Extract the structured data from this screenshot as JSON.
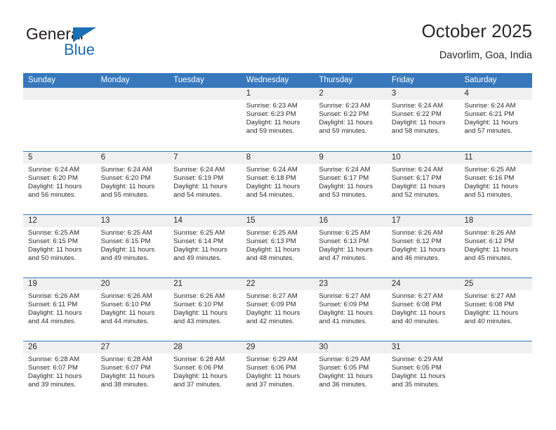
{
  "brand": {
    "name_part1": "General",
    "name_part2": "Blue",
    "triangle_color": "#1a6fb4"
  },
  "header": {
    "title": "October 2025",
    "subtitle": "Davorlim, Goa, India"
  },
  "theme": {
    "header_blue": "#3778bd",
    "day_band_gray": "#f0f0f0",
    "text_color": "#2b2b2b"
  },
  "weekdays": [
    "Sunday",
    "Monday",
    "Tuesday",
    "Wednesday",
    "Thursday",
    "Friday",
    "Saturday"
  ],
  "weeks": [
    [
      {
        "day": "",
        "sunrise": "",
        "sunset": "",
        "daylight_line1": "",
        "daylight_line2": "",
        "empty": true
      },
      {
        "day": "",
        "sunrise": "",
        "sunset": "",
        "daylight_line1": "",
        "daylight_line2": "",
        "empty": true
      },
      {
        "day": "",
        "sunrise": "",
        "sunset": "",
        "daylight_line1": "",
        "daylight_line2": "",
        "empty": true
      },
      {
        "day": "1",
        "sunrise": "Sunrise: 6:23 AM",
        "sunset": "Sunset: 6:23 PM",
        "daylight_line1": "Daylight: 11 hours",
        "daylight_line2": "and 59 minutes.",
        "empty": false
      },
      {
        "day": "2",
        "sunrise": "Sunrise: 6:23 AM",
        "sunset": "Sunset: 6:22 PM",
        "daylight_line1": "Daylight: 11 hours",
        "daylight_line2": "and 59 minutes.",
        "empty": false
      },
      {
        "day": "3",
        "sunrise": "Sunrise: 6:24 AM",
        "sunset": "Sunset: 6:22 PM",
        "daylight_line1": "Daylight: 11 hours",
        "daylight_line2": "and 58 minutes.",
        "empty": false
      },
      {
        "day": "4",
        "sunrise": "Sunrise: 6:24 AM",
        "sunset": "Sunset: 6:21 PM",
        "daylight_line1": "Daylight: 11 hours",
        "daylight_line2": "and 57 minutes.",
        "empty": false
      }
    ],
    [
      {
        "day": "5",
        "sunrise": "Sunrise: 6:24 AM",
        "sunset": "Sunset: 6:20 PM",
        "daylight_line1": "Daylight: 11 hours",
        "daylight_line2": "and 56 minutes.",
        "empty": false
      },
      {
        "day": "6",
        "sunrise": "Sunrise: 6:24 AM",
        "sunset": "Sunset: 6:20 PM",
        "daylight_line1": "Daylight: 11 hours",
        "daylight_line2": "and 55 minutes.",
        "empty": false
      },
      {
        "day": "7",
        "sunrise": "Sunrise: 6:24 AM",
        "sunset": "Sunset: 6:19 PM",
        "daylight_line1": "Daylight: 11 hours",
        "daylight_line2": "and 54 minutes.",
        "empty": false
      },
      {
        "day": "8",
        "sunrise": "Sunrise: 6:24 AM",
        "sunset": "Sunset: 6:18 PM",
        "daylight_line1": "Daylight: 11 hours",
        "daylight_line2": "and 54 minutes.",
        "empty": false
      },
      {
        "day": "9",
        "sunrise": "Sunrise: 6:24 AM",
        "sunset": "Sunset: 6:17 PM",
        "daylight_line1": "Daylight: 11 hours",
        "daylight_line2": "and 53 minutes.",
        "empty": false
      },
      {
        "day": "10",
        "sunrise": "Sunrise: 6:24 AM",
        "sunset": "Sunset: 6:17 PM",
        "daylight_line1": "Daylight: 11 hours",
        "daylight_line2": "and 52 minutes.",
        "empty": false
      },
      {
        "day": "11",
        "sunrise": "Sunrise: 6:25 AM",
        "sunset": "Sunset: 6:16 PM",
        "daylight_line1": "Daylight: 11 hours",
        "daylight_line2": "and 51 minutes.",
        "empty": false
      }
    ],
    [
      {
        "day": "12",
        "sunrise": "Sunrise: 6:25 AM",
        "sunset": "Sunset: 6:15 PM",
        "daylight_line1": "Daylight: 11 hours",
        "daylight_line2": "and 50 minutes.",
        "empty": false
      },
      {
        "day": "13",
        "sunrise": "Sunrise: 6:25 AM",
        "sunset": "Sunset: 6:15 PM",
        "daylight_line1": "Daylight: 11 hours",
        "daylight_line2": "and 49 minutes.",
        "empty": false
      },
      {
        "day": "14",
        "sunrise": "Sunrise: 6:25 AM",
        "sunset": "Sunset: 6:14 PM",
        "daylight_line1": "Daylight: 11 hours",
        "daylight_line2": "and 49 minutes.",
        "empty": false
      },
      {
        "day": "15",
        "sunrise": "Sunrise: 6:25 AM",
        "sunset": "Sunset: 6:13 PM",
        "daylight_line1": "Daylight: 11 hours",
        "daylight_line2": "and 48 minutes.",
        "empty": false
      },
      {
        "day": "16",
        "sunrise": "Sunrise: 6:25 AM",
        "sunset": "Sunset: 6:13 PM",
        "daylight_line1": "Daylight: 11 hours",
        "daylight_line2": "and 47 minutes.",
        "empty": false
      },
      {
        "day": "17",
        "sunrise": "Sunrise: 6:26 AM",
        "sunset": "Sunset: 6:12 PM",
        "daylight_line1": "Daylight: 11 hours",
        "daylight_line2": "and 46 minutes.",
        "empty": false
      },
      {
        "day": "18",
        "sunrise": "Sunrise: 6:26 AM",
        "sunset": "Sunset: 6:12 PM",
        "daylight_line1": "Daylight: 11 hours",
        "daylight_line2": "and 45 minutes.",
        "empty": false
      }
    ],
    [
      {
        "day": "19",
        "sunrise": "Sunrise: 6:26 AM",
        "sunset": "Sunset: 6:11 PM",
        "daylight_line1": "Daylight: 11 hours",
        "daylight_line2": "and 44 minutes.",
        "empty": false
      },
      {
        "day": "20",
        "sunrise": "Sunrise: 6:26 AM",
        "sunset": "Sunset: 6:10 PM",
        "daylight_line1": "Daylight: 11 hours",
        "daylight_line2": "and 44 minutes.",
        "empty": false
      },
      {
        "day": "21",
        "sunrise": "Sunrise: 6:26 AM",
        "sunset": "Sunset: 6:10 PM",
        "daylight_line1": "Daylight: 11 hours",
        "daylight_line2": "and 43 minutes.",
        "empty": false
      },
      {
        "day": "22",
        "sunrise": "Sunrise: 6:27 AM",
        "sunset": "Sunset: 6:09 PM",
        "daylight_line1": "Daylight: 11 hours",
        "daylight_line2": "and 42 minutes.",
        "empty": false
      },
      {
        "day": "23",
        "sunrise": "Sunrise: 6:27 AM",
        "sunset": "Sunset: 6:09 PM",
        "daylight_line1": "Daylight: 11 hours",
        "daylight_line2": "and 41 minutes.",
        "empty": false
      },
      {
        "day": "24",
        "sunrise": "Sunrise: 6:27 AM",
        "sunset": "Sunset: 6:08 PM",
        "daylight_line1": "Daylight: 11 hours",
        "daylight_line2": "and 40 minutes.",
        "empty": false
      },
      {
        "day": "25",
        "sunrise": "Sunrise: 6:27 AM",
        "sunset": "Sunset: 6:08 PM",
        "daylight_line1": "Daylight: 11 hours",
        "daylight_line2": "and 40 minutes.",
        "empty": false
      }
    ],
    [
      {
        "day": "26",
        "sunrise": "Sunrise: 6:28 AM",
        "sunset": "Sunset: 6:07 PM",
        "daylight_line1": "Daylight: 11 hours",
        "daylight_line2": "and 39 minutes.",
        "empty": false
      },
      {
        "day": "27",
        "sunrise": "Sunrise: 6:28 AM",
        "sunset": "Sunset: 6:07 PM",
        "daylight_line1": "Daylight: 11 hours",
        "daylight_line2": "and 38 minutes.",
        "empty": false
      },
      {
        "day": "28",
        "sunrise": "Sunrise: 6:28 AM",
        "sunset": "Sunset: 6:06 PM",
        "daylight_line1": "Daylight: 11 hours",
        "daylight_line2": "and 37 minutes.",
        "empty": false
      },
      {
        "day": "29",
        "sunrise": "Sunrise: 6:29 AM",
        "sunset": "Sunset: 6:06 PM",
        "daylight_line1": "Daylight: 11 hours",
        "daylight_line2": "and 37 minutes.",
        "empty": false
      },
      {
        "day": "30",
        "sunrise": "Sunrise: 6:29 AM",
        "sunset": "Sunset: 6:05 PM",
        "daylight_line1": "Daylight: 11 hours",
        "daylight_line2": "and 36 minutes.",
        "empty": false
      },
      {
        "day": "31",
        "sunrise": "Sunrise: 6:29 AM",
        "sunset": "Sunset: 6:05 PM",
        "daylight_line1": "Daylight: 11 hours",
        "daylight_line2": "and 35 minutes.",
        "empty": false
      },
      {
        "day": "",
        "sunrise": "",
        "sunset": "",
        "daylight_line1": "",
        "daylight_line2": "",
        "empty": true
      }
    ]
  ]
}
